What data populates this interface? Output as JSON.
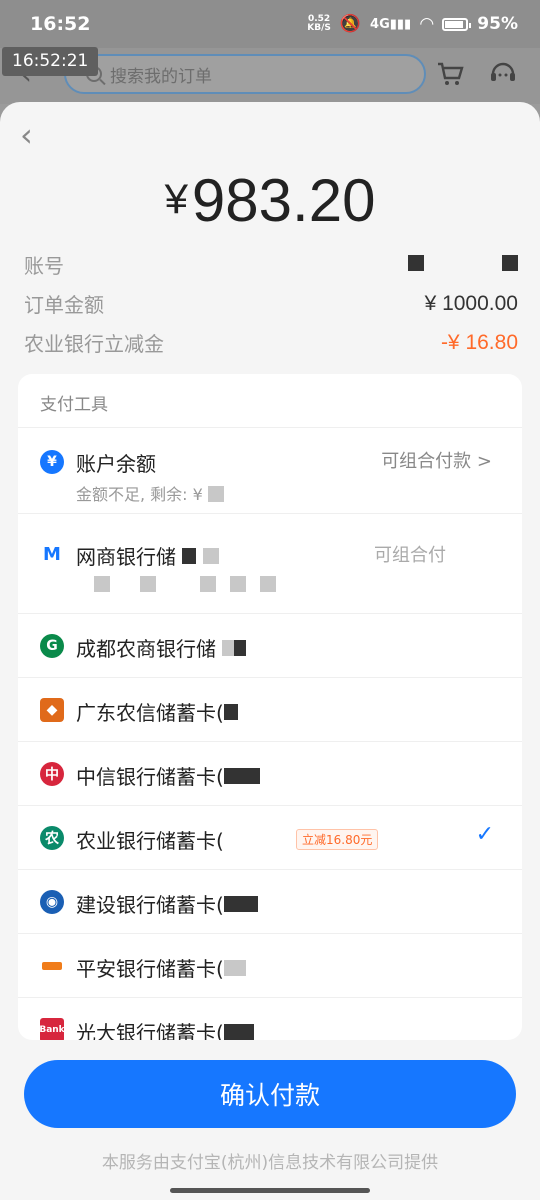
{
  "status_bar": {
    "time": "16:52",
    "net_speed_value": "0.52",
    "net_speed_unit": "KB/S",
    "battery": "95%"
  },
  "overlay_timestamp": "16:52:21",
  "background_header": {
    "search_placeholder": "搜索我的订单"
  },
  "payment": {
    "currency_symbol": "¥",
    "amount": "983.20",
    "rows": [
      {
        "label": "账号",
        "value": ""
      },
      {
        "label": "订单金额",
        "value": "¥ 1000.00"
      },
      {
        "label": "农业银行立减金",
        "value": "-¥ 16.80"
      }
    ],
    "section_title": "支付工具",
    "methods": [
      {
        "name": "账户余额",
        "sub": "金额不足, 剩余: ¥",
        "right": "可组合付款 >",
        "icon": "yuan-icon",
        "color": "#1677ff"
      },
      {
        "name": "网商银行储",
        "sub": "",
        "right": "可组合付",
        "icon": "mybank-icon",
        "color": "#1677ff"
      },
      {
        "name": "成都农商银行储",
        "sub": "",
        "right": "",
        "icon": "cdrcb-icon",
        "color": "#0a8a4a"
      },
      {
        "name": "广东农信储蓄卡(",
        "sub": "",
        "right": "",
        "icon": "gdrc-icon",
        "color": "#e06a1a"
      },
      {
        "name": "中信银行储蓄卡(",
        "sub": "",
        "right": "",
        "icon": "citic-icon",
        "color": "#d7263d"
      },
      {
        "name": "农业银行储蓄卡(",
        "sub": "",
        "right": "",
        "icon": "abc-icon",
        "color": "#0a8a6a",
        "tag": "立减16.80元",
        "selected": true
      },
      {
        "name": "建设银行储蓄卡(",
        "sub": "",
        "right": "",
        "icon": "ccb-icon",
        "color": "#1a5fb4"
      },
      {
        "name": "平安银行储蓄卡(",
        "sub": "",
        "right": "",
        "icon": "pingan-icon",
        "color": "#f07c1a"
      },
      {
        "name": "光大银行储蓄卡(",
        "sub": "",
        "right": "",
        "icon": "ceb-icon",
        "color": "#d7263d"
      }
    ],
    "confirm_label": "确认付款",
    "footer": "本服务由支付宝(杭州)信息技术有限公司提供"
  }
}
